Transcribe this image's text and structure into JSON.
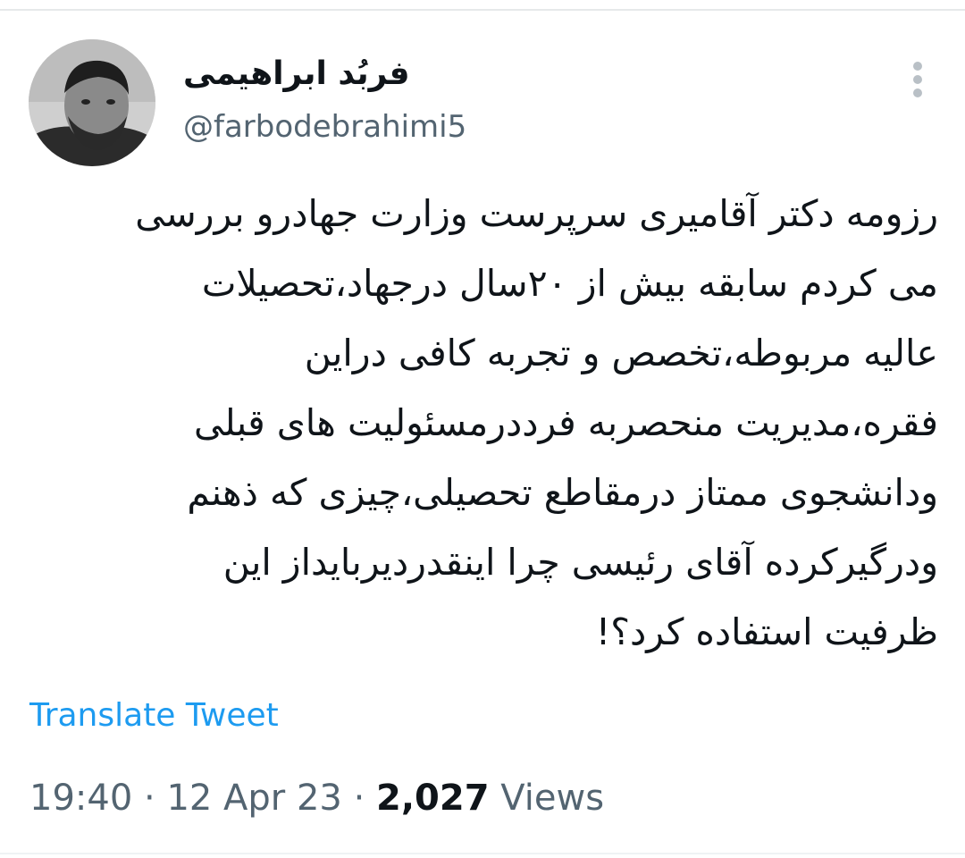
{
  "tweet": {
    "author": {
      "display_name": "فربُد ابراهیمی",
      "handle": "@farbodebrahimi5",
      "avatar_icon": "profile-photo"
    },
    "more_icon": "vertical-ellipsis-icon",
    "text_lines": [
      "رزومه دکتر آقامیری سرپرست وزارت جهادرو بررسی",
      "می کردم سابقه بیش از ۲۰سال درجهاد،تحصیلات",
      "عالیه مربوطه،تخصص و تجربه کافی دراین",
      "فقره،مدیریت منحصربه فرددرمسئولیت های قبلی",
      "ودانشجوی ممتاز درمقاطع تحصیلی،چیزی که ذهنم",
      "ودرگیرکرده آقای رئیسی چرا اینقدردیربایداز این",
      "ظرفیت استفاده کرد؟!"
    ],
    "translate_label": "Translate Tweet",
    "time": "19:40",
    "separator": "·",
    "date": "12 Apr 23",
    "views_count": "2,027",
    "views_label": "Views"
  },
  "colors": {
    "text_primary": "#0f1419",
    "text_secondary": "#536471",
    "link": "#1d9bf0",
    "divider": "#eff3f4"
  }
}
